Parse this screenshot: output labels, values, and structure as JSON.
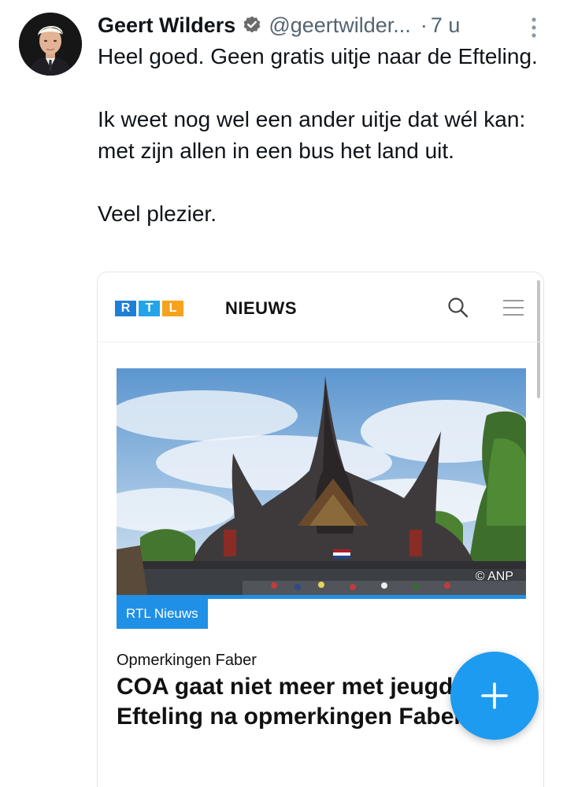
{
  "tweet": {
    "author_name": "Geert Wilders",
    "handle": "@geertwilder...",
    "separator": "·",
    "time": "7 u",
    "paragraphs": [
      "Heel goed. Geen gratis uitje naar de Efteling.",
      "Ik weet nog wel een ander uitje dat wél kan: met zijn allen in een bus het land uit.",
      "Veel plezier."
    ]
  },
  "card": {
    "logo_letters": [
      "R",
      "T",
      "L"
    ],
    "brand_word": "NIEUWS",
    "image_credit": "© ANP",
    "source_tag": "RTL Nieuws",
    "kicker": "Opmerkingen Faber",
    "headline": "COA gaat niet meer met jeugd naar Efteling na opmerkingen Faber"
  },
  "icons": {
    "verified": "verified-badge-icon",
    "more": "more-vertical-icon",
    "search": "search-icon",
    "menu": "hamburger-menu-icon",
    "compose": "plus-icon"
  },
  "colors": {
    "accent": "#1d9bf0",
    "rtl_blue": "#1f7fd6",
    "rtl_cyan": "#24a4e8",
    "rtl_orange": "#f7a21b",
    "muted_text": "#536471"
  }
}
